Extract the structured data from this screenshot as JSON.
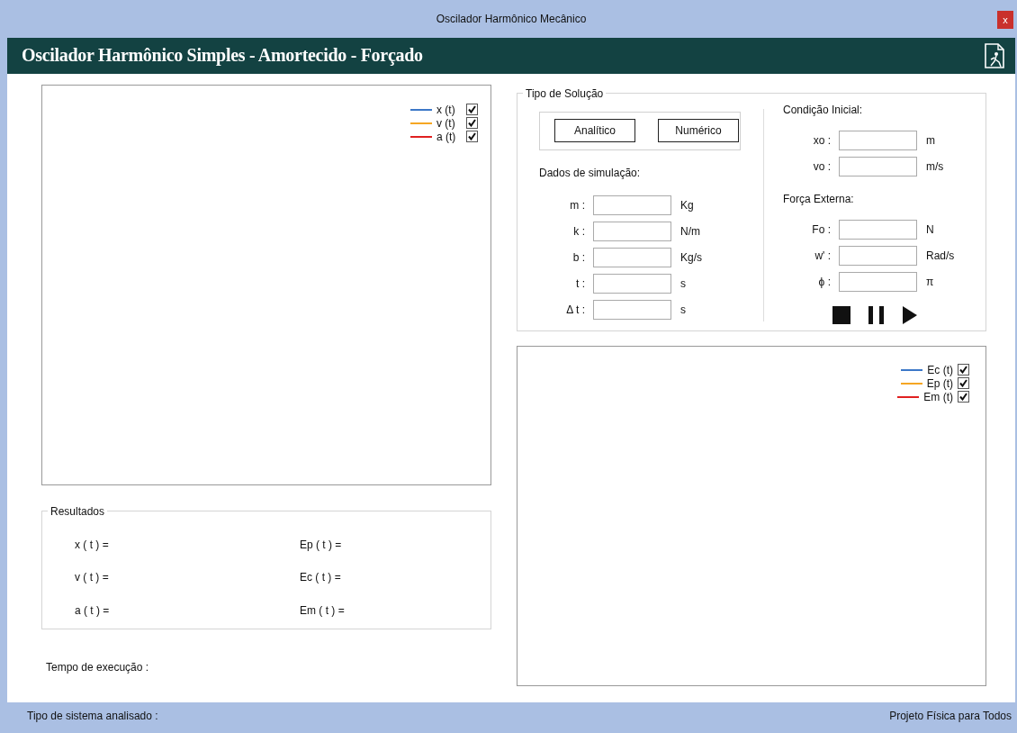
{
  "window": {
    "title": "Oscilador Harmônico Mecânico",
    "close_label": "x"
  },
  "header": {
    "title": "Oscilador Harmônico Simples - Amortecido - Forçado"
  },
  "motion_chart": {
    "legend": [
      {
        "label": "x (t)",
        "color": "#3c78c8",
        "checked": true
      },
      {
        "label": "v (t)",
        "color": "#f5a623",
        "checked": true
      },
      {
        "label": "a (t)",
        "color": "#e02020",
        "checked": true
      }
    ]
  },
  "results": {
    "legend": "Resultados",
    "left": [
      "x ( t ) =",
      "v ( t ) =",
      "a ( t ) ="
    ],
    "right": [
      "Ep ( t ) =",
      "Ec ( t ) =",
      "Em ( t ) ="
    ]
  },
  "execution_time": "Tempo de execução :",
  "solution": {
    "legend": "Tipo de Solução",
    "buttons": [
      "Analítico",
      "Numérico"
    ],
    "simulation_heading": "Dados de simulação:",
    "simulation_fields": [
      {
        "label": "m :",
        "unit": "Kg"
      },
      {
        "label": "k :",
        "unit": "N/m"
      },
      {
        "label": "b :",
        "unit": "Kg/s"
      },
      {
        "label": "t :",
        "unit": "s"
      },
      {
        "label": "Δ t :",
        "unit": "s"
      }
    ],
    "initial_heading": "Condição Inicial:",
    "initial_fields": [
      {
        "label": "xo :",
        "unit": "m"
      },
      {
        "label": "vo :",
        "unit": "m/s"
      }
    ],
    "force_heading": "Força Externa:",
    "force_fields": [
      {
        "label": "Fo :",
        "unit": "N"
      },
      {
        "label": "w' :",
        "unit": "Rad/s"
      },
      {
        "label": "ϕ :",
        "unit": "π"
      }
    ],
    "controls": [
      {
        "kind": "stop"
      },
      {
        "kind": "pause"
      },
      {
        "kind": "play"
      }
    ]
  },
  "energy_chart": {
    "legend": [
      {
        "label": "Ec (t)",
        "color": "#3c78c8",
        "checked": true
      },
      {
        "label": "Ep (t)",
        "color": "#f5a623",
        "checked": true
      },
      {
        "label": "Em (t)",
        "color": "#e02020",
        "checked": true
      }
    ]
  },
  "status_bar": {
    "left": "Tipo de sistema analisado :",
    "right": "Projeto Física para Todos"
  }
}
